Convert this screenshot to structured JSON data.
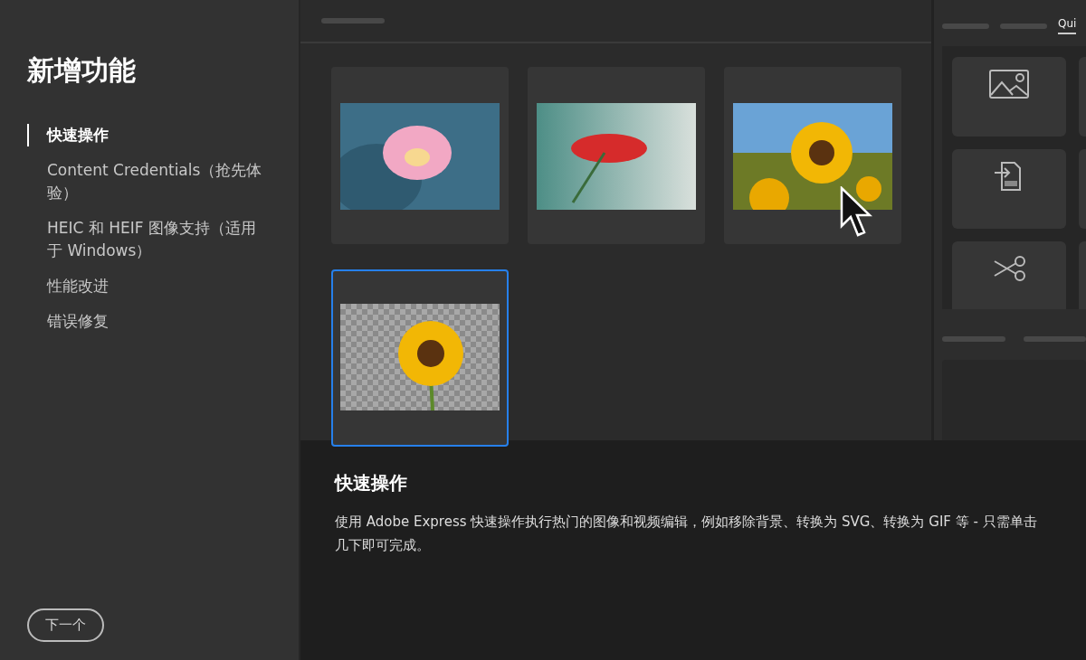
{
  "sidebar": {
    "title": "新增功能",
    "items": [
      {
        "label": "快速操作",
        "selected": true
      },
      {
        "label": "Content Credentials（抢先体验）",
        "selected": false
      },
      {
        "label": "HEIC 和 HEIF 图像支持（适用于 Windows）",
        "selected": false
      },
      {
        "label": "性能改进",
        "selected": false
      },
      {
        "label": "错误修复",
        "selected": false
      }
    ],
    "next_button": "下一个"
  },
  "gallery": {
    "thumbnails": [
      {
        "kind": "lotus",
        "selected": false
      },
      {
        "kind": "flower",
        "selected": false
      },
      {
        "kind": "field",
        "selected": false
      },
      {
        "kind": "cutout",
        "selected": true
      }
    ]
  },
  "right_panel": {
    "tab": "Qui",
    "tiles": [
      {
        "kind": "image"
      },
      {
        "kind": "svg"
      },
      {
        "kind": "scissors"
      }
    ]
  },
  "description": {
    "title": "快速操作",
    "body": "使用 Adobe Express 快速操作执行热门的图像和视频编辑，例如移除背景、转换为 SVG、转换为 GIF 等 - 只需单击几下即可完成。"
  }
}
